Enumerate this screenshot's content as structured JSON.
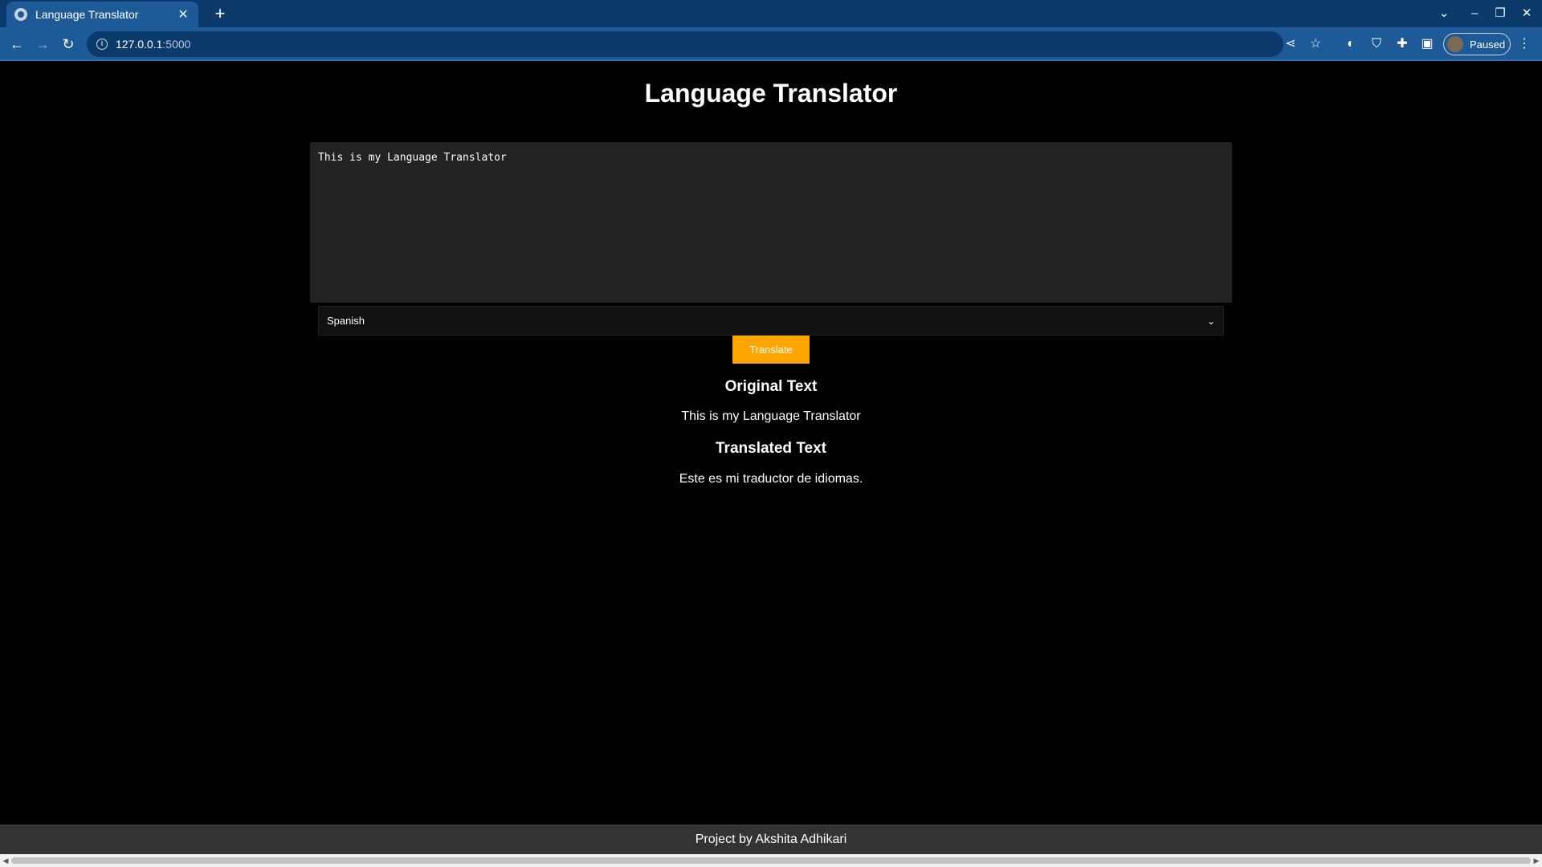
{
  "browser": {
    "tab_title": "Language Translator",
    "tab_close": "✕",
    "new_tab": "+",
    "url_host": "127.0.0.1",
    "url_port": ":5000",
    "profile_label": "Paused"
  },
  "app": {
    "title": "Language Translator",
    "input_value": "This is my Language Translator",
    "selected_language": "Spanish",
    "translate_label": "Translate",
    "original_heading": "Original Text",
    "original_text": "This is my Language Translator",
    "translated_heading": "Translated Text",
    "translated_text": "Este es mi traductor de idiomas.",
    "footer": "Project by Akshita Adhikari"
  },
  "colors": {
    "accent": "#ffa500",
    "browser_frame": "#0b3a6b",
    "toolbar": "#1d5a97"
  },
  "icons": [
    "globe-icon",
    "back-icon",
    "forward-icon",
    "reload-icon",
    "info-icon",
    "share-icon",
    "star-icon",
    "extension-icon",
    "shield-icon",
    "puzzle-icon",
    "sidepanel-icon",
    "menu-icon",
    "minimize-icon",
    "restore-icon",
    "close-icon",
    "chevron-down-icon"
  ]
}
